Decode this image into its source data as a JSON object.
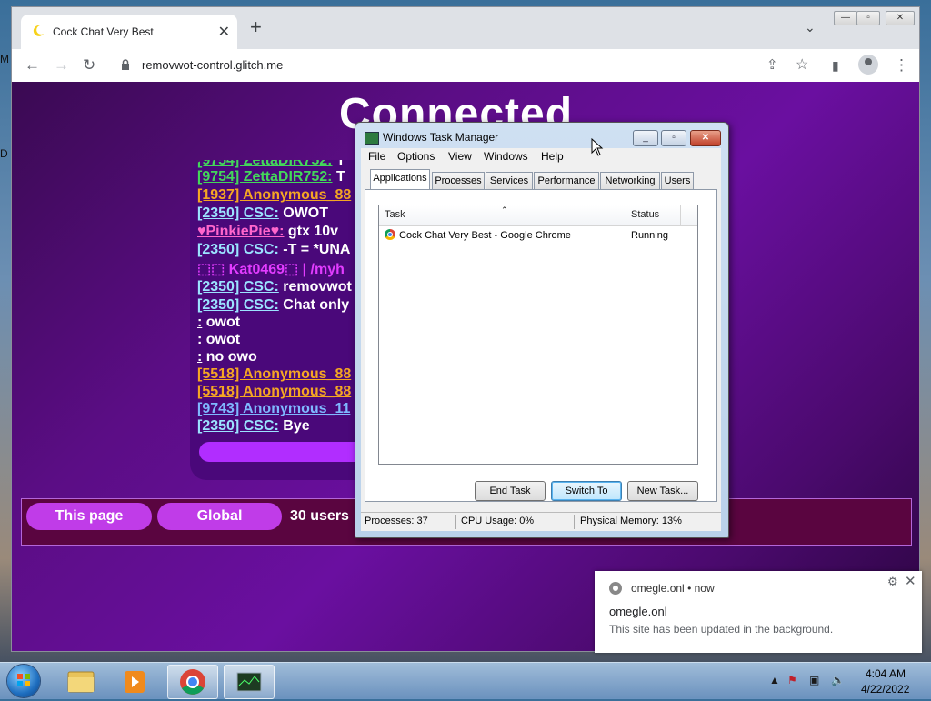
{
  "desktop": {
    "left_letters": [
      "M",
      "D"
    ]
  },
  "browser": {
    "tab_title": "Cock Chat Very Best",
    "url": "removwot-control.glitch.me",
    "new_tab_icon": "plus-icon",
    "window_controls": {
      "minimize": "—",
      "maximize": "▫",
      "close": "✕"
    }
  },
  "page": {
    "heading": "Connected",
    "chat_messages": [
      {
        "name": "[9754] ZettaDIR752:",
        "text": " T",
        "color": "#43d85a"
      },
      {
        "name": "[9754] ZettaDIR752:",
        "text": " T",
        "color": "#43d85a"
      },
      {
        "name": "[1937] Anonymous_88",
        "text": "",
        "color": "#f5a623"
      },
      {
        "name": "[2350] CSC:",
        "text": " OWOT",
        "color": "#9be3ff"
      },
      {
        "name": "♥PinkiePie♥:",
        "text": " gtx 10v",
        "color": "#ff66cc"
      },
      {
        "name": "[2350] CSC:",
        "text": " -T = *UNA",
        "color": "#9be3ff"
      },
      {
        "name": "⬚⬚ Kat0469⬚ | /myh",
        "text": "",
        "color": "#e23cff"
      },
      {
        "name": "[2350] CSC:",
        "text": " removwot",
        "color": "#9be3ff"
      },
      {
        "name": "[2350] CSC:",
        "text": " Chat only",
        "color": "#9be3ff"
      },
      {
        "name": ":",
        "text": " owot",
        "color": "#ffffff"
      },
      {
        "name": ":",
        "text": " owot",
        "color": "#ffffff"
      },
      {
        "name": ":",
        "text": " no owo",
        "color": "#ffffff"
      },
      {
        "name": "[5518] Anonymous_88",
        "text": "",
        "color": "#f5a623"
      },
      {
        "name": "[5518] Anonymous_88",
        "text": "",
        "color": "#f5a623"
      },
      {
        "name": "[9743] Anonymous_11",
        "text": "",
        "color": "#7fb8ff"
      },
      {
        "name": "[2350] CSC:",
        "text": " Bye",
        "color": "#9be3ff"
      }
    ],
    "this_page_button": "This page",
    "global_button": "Global",
    "users_text": "30 users"
  },
  "task_manager": {
    "title": "Windows Task Manager",
    "menu": [
      "File",
      "Options",
      "View",
      "Windows",
      "Help"
    ],
    "tabs": [
      "Applications",
      "Processes",
      "Services",
      "Performance",
      "Networking",
      "Users"
    ],
    "columns": {
      "task": "Task",
      "status": "Status"
    },
    "rows": [
      {
        "task": "Cock Chat Very Best - Google Chrome",
        "status": "Running"
      }
    ],
    "buttons": {
      "end_task": "End Task",
      "switch_to": "Switch To",
      "new_task": "New Task..."
    },
    "status_bar": {
      "processes": "Processes: 37",
      "cpu": "CPU Usage: 0%",
      "memory": "Physical Memory: 13%"
    }
  },
  "notification": {
    "source": "omegle.onl",
    "time": "• now",
    "title": "omegle.onl",
    "body": "This site has been updated in the background."
  },
  "taskbar": {
    "time": "4:04 AM",
    "date": "4/22/2022",
    "items": [
      "explorer",
      "media-player",
      "chrome",
      "task-manager"
    ]
  }
}
